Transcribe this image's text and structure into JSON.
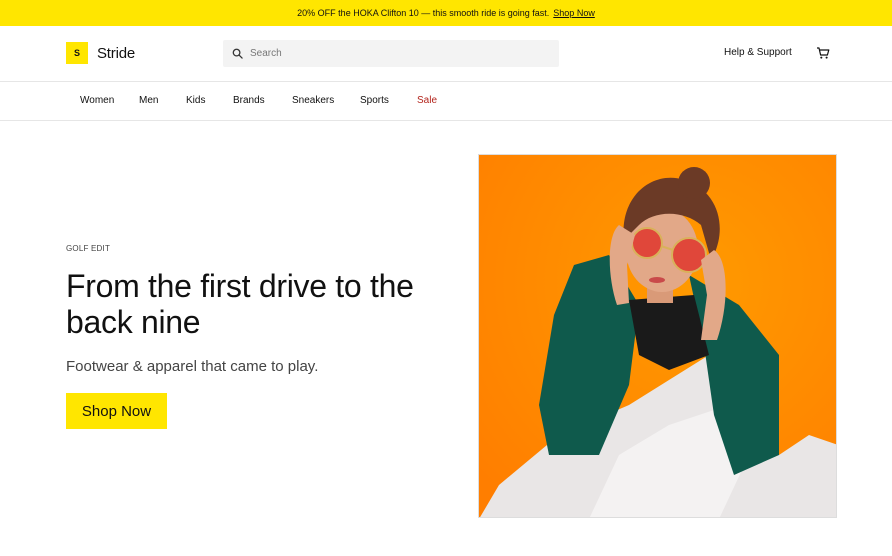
{
  "promo": {
    "text": "20% OFF the HOKA Clifton 10 — this smooth ride is going fast.",
    "link": "Shop Now"
  },
  "header": {
    "logo_mark": "S",
    "logo_text": "Stride",
    "search_placeholder": "Search",
    "help": "Help & Support"
  },
  "nav": {
    "items": [
      {
        "label": "Women"
      },
      {
        "label": "Men"
      },
      {
        "label": "Kids"
      },
      {
        "label": "Brands"
      },
      {
        "label": "Sneakers"
      },
      {
        "label": "Sports"
      },
      {
        "label": "Sale"
      }
    ]
  },
  "hero": {
    "eyebrow": "GOLF EDIT",
    "headline": "From the first drive to the back nine",
    "subhead": "Footwear & apparel that came to play.",
    "cta": "Shop Now"
  },
  "colors": {
    "accent": "#ffe600",
    "sale": "#b3251d",
    "hero_background": "#ff8a00"
  }
}
